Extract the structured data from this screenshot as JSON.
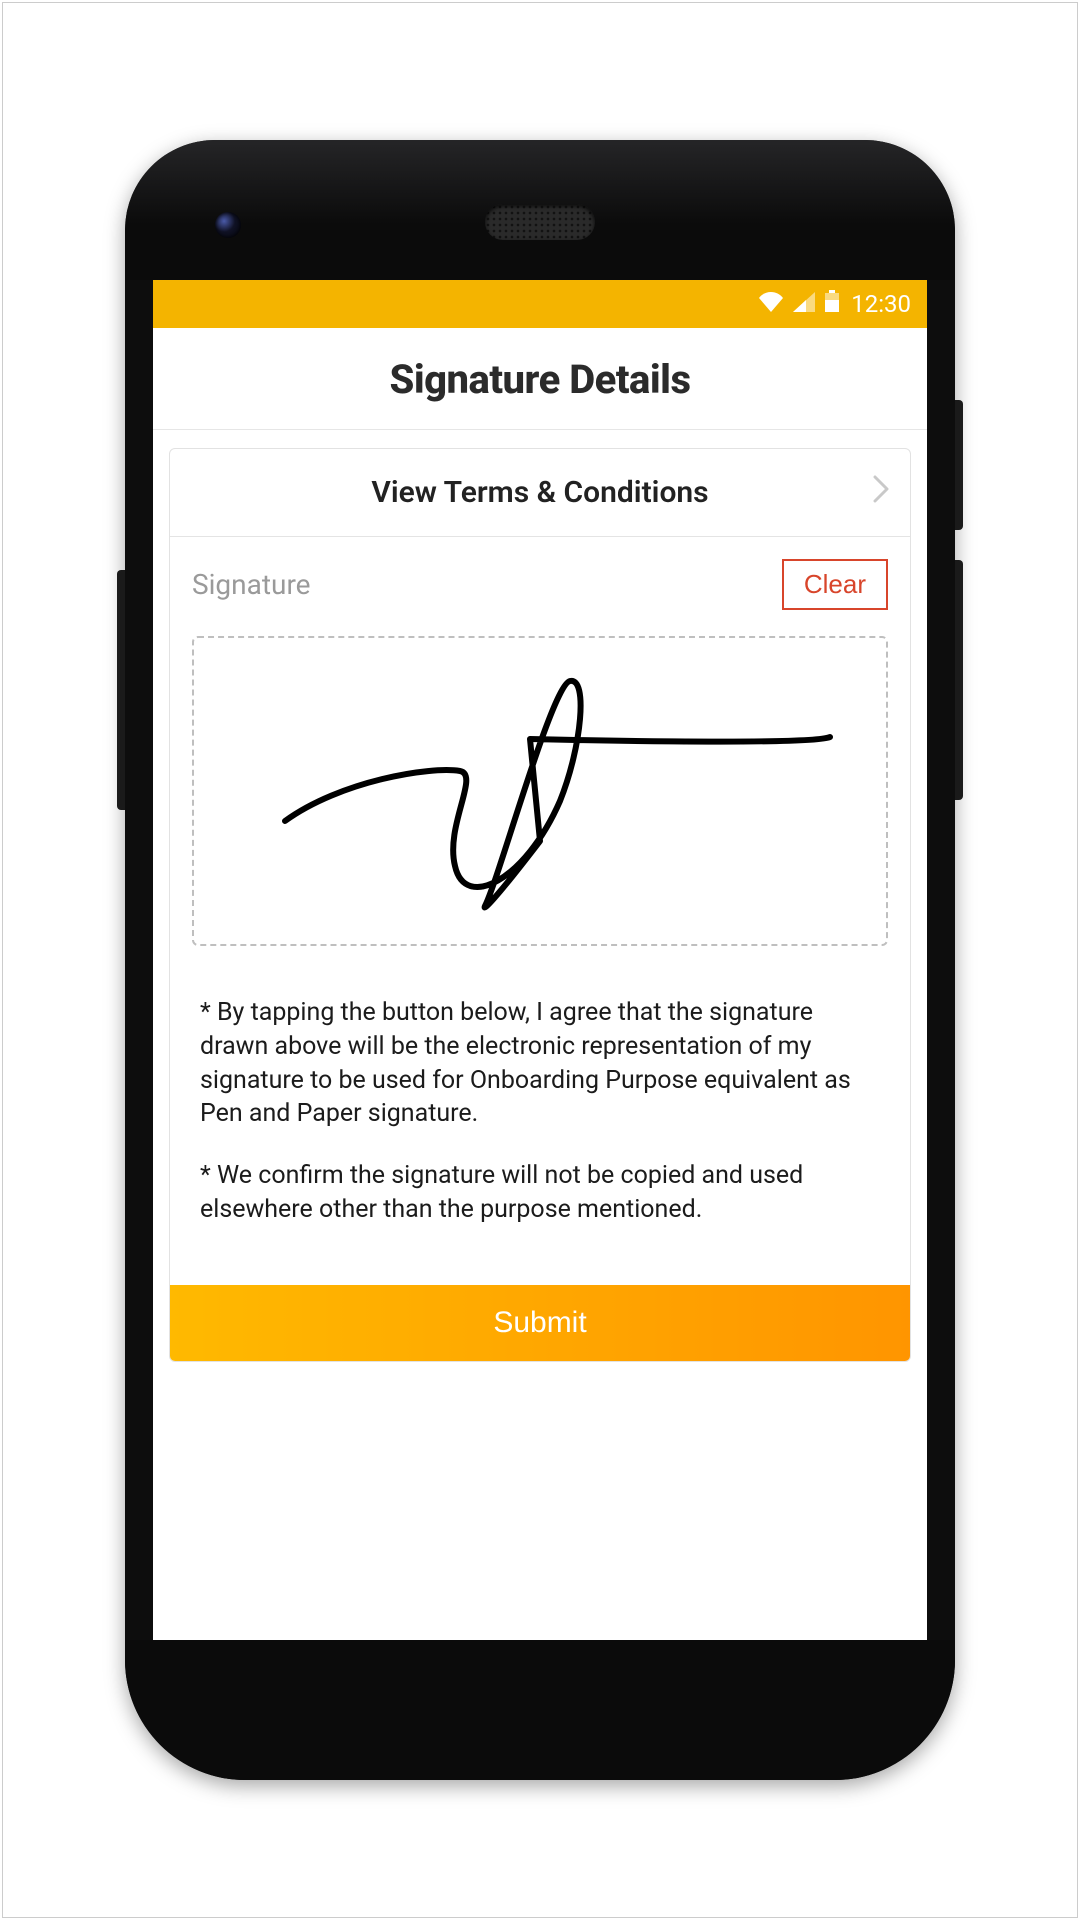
{
  "status_bar": {
    "time": "12:30"
  },
  "header": {
    "title": "Signature Details"
  },
  "terms": {
    "label": "View Terms & Conditions"
  },
  "signature": {
    "label": "Signature",
    "clear_label": "Clear"
  },
  "disclaimer": {
    "para1": "* By tapping the button below, I agree that the signature drawn above will be the electronic representation of my signature to be used for Onboarding Purpose equivalent as Pen and Paper signature.",
    "para2": " * We confirm the signature will not be copied and used elsewhere other than the purpose mentioned."
  },
  "actions": {
    "submit_label": "Submit"
  }
}
